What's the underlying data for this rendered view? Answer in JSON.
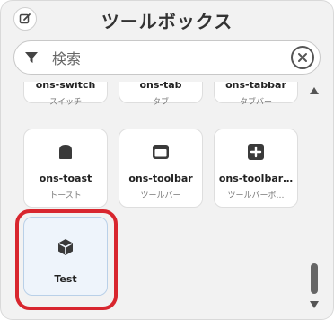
{
  "header": {
    "title": "ツールボックス",
    "edit_icon": "edit-icon"
  },
  "search": {
    "placeholder": "検索",
    "value": "",
    "filter_icon": "filter-icon",
    "clear_icon": "clear-icon"
  },
  "tiles_partial": [
    {
      "name": "ons-switch",
      "sub": "スイッチ"
    },
    {
      "name": "ons-tab",
      "sub": "タブ"
    },
    {
      "name": "ons-tabbar",
      "sub": "タブバー"
    }
  ],
  "tiles_row": [
    {
      "name": "ons-toast",
      "sub": "トースト",
      "icon": "toast-icon"
    },
    {
      "name": "ons-toolbar",
      "sub": "ツールバー",
      "icon": "toolbar-icon"
    },
    {
      "name": "ons-toolbar…",
      "sub": "ツールバーボ…",
      "icon": "toolbar-button-icon"
    }
  ],
  "selected_tile": {
    "name": "Test",
    "icon": "cube-icon"
  },
  "colors": {
    "highlight": "#d8262e",
    "selected_bg": "#eef4fb"
  }
}
